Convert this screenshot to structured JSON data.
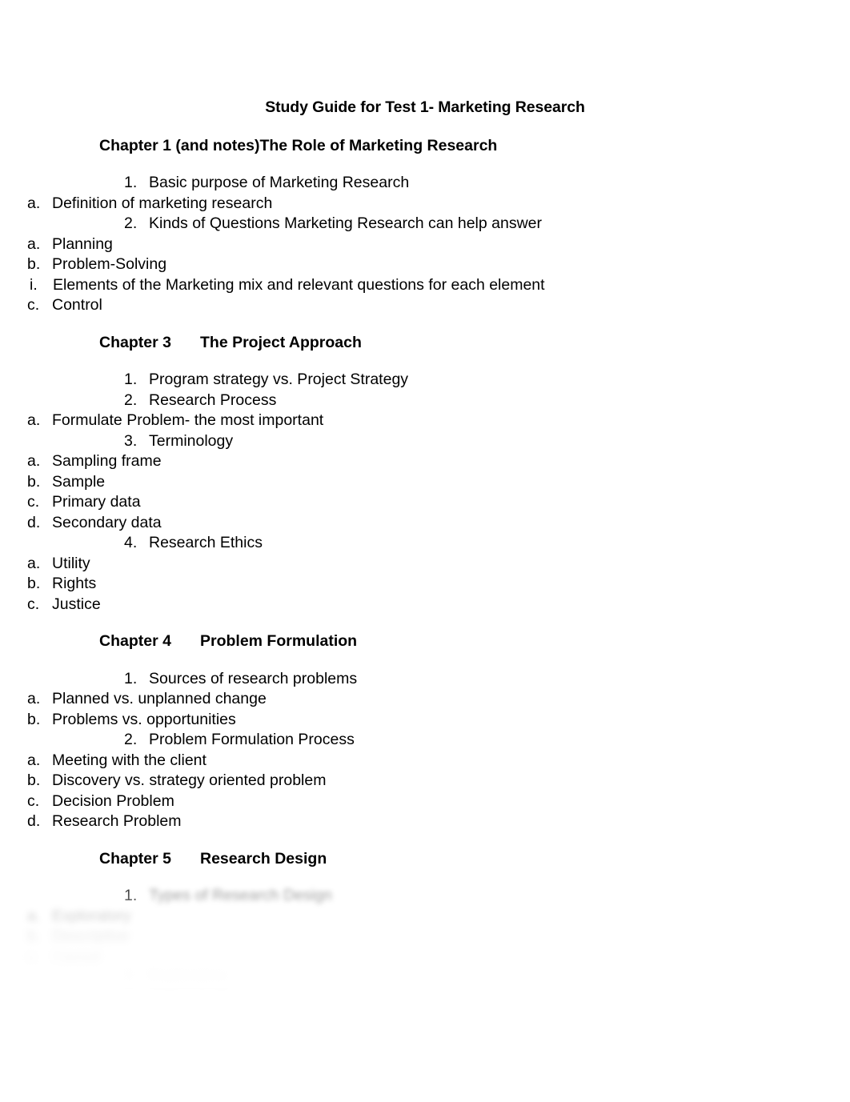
{
  "document": {
    "title": "Study Guide for Test 1- Marketing Research",
    "background_color": "#ffffff",
    "text_color": "#000000"
  },
  "sections": [
    {
      "heading_label": "Chapter 1 (and notes)",
      "heading_title": "The Role of Marketing Research",
      "items": [
        {
          "marker": "1.",
          "text": "Basic purpose of Marketing Research",
          "children": [
            {
              "marker": "a.",
              "text": "Definition of marketing research"
            }
          ]
        },
        {
          "marker": "2.",
          "text": "Kinds of Questions Marketing Research can help answer",
          "children": [
            {
              "marker": "a.",
              "text": "Planning"
            },
            {
              "marker": "b.",
              "text": "Problem-Solving",
              "children": [
                {
                  "marker": "i.",
                  "text": "Elements of the Marketing mix and relevant questions for each element"
                }
              ]
            },
            {
              "marker": "c.",
              "text": "Control"
            }
          ]
        }
      ]
    },
    {
      "heading_label": "Chapter 3",
      "heading_title": "The Project Approach",
      "items": [
        {
          "marker": "1.",
          "text": "Program strategy vs. Project Strategy"
        },
        {
          "marker": "2.",
          "text": "Research Process",
          "children": [
            {
              "marker": "a.",
              "text": "Formulate Problem- the most important"
            }
          ]
        },
        {
          "marker": "3.",
          "text": "Terminology",
          "children": [
            {
              "marker": "a.",
              "text": "Sampling frame"
            },
            {
              "marker": "b.",
              "text": "Sample"
            },
            {
              "marker": "c.",
              "text": "Primary data"
            },
            {
              "marker": "d.",
              "text": "Secondary data"
            }
          ]
        },
        {
          "marker": "4.",
          "text": "Research Ethics",
          "children": [
            {
              "marker": "a.",
              "text": "Utility"
            },
            {
              "marker": "b.",
              "text": "Rights"
            },
            {
              "marker": "c.",
              "text": "Justice"
            }
          ]
        }
      ]
    },
    {
      "heading_label": "Chapter 4",
      "heading_title": "Problem Formulation",
      "items": [
        {
          "marker": "1.",
          "text": "Sources of research problems",
          "children": [
            {
              "marker": "a.",
              "text": "Planned vs. unplanned change"
            },
            {
              "marker": "b.",
              "text": "Problems vs. opportunities"
            }
          ]
        },
        {
          "marker": "2.",
          "text": "Problem Formulation Process",
          "children": [
            {
              "marker": "a.",
              "text": "Meeting with the client"
            },
            {
              "marker": "b.",
              "text": "Discovery vs. strategy oriented problem"
            },
            {
              "marker": "c.",
              "text": "Decision Problem"
            },
            {
              "marker": "d.",
              "text": "Research Problem"
            }
          ]
        }
      ]
    },
    {
      "heading_label": "Chapter 5",
      "heading_title": "Research Design",
      "items": [
        {
          "marker": "1.",
          "text": "Types of Research Design",
          "children": [
            {
              "marker": "a.",
              "text": "Exploratory"
            },
            {
              "marker": "b.",
              "text": "Descriptive"
            },
            {
              "marker": "c.",
              "text": "Causal"
            }
          ]
        },
        {
          "marker": "2.",
          "text": "Exploratory"
        }
      ]
    }
  ]
}
